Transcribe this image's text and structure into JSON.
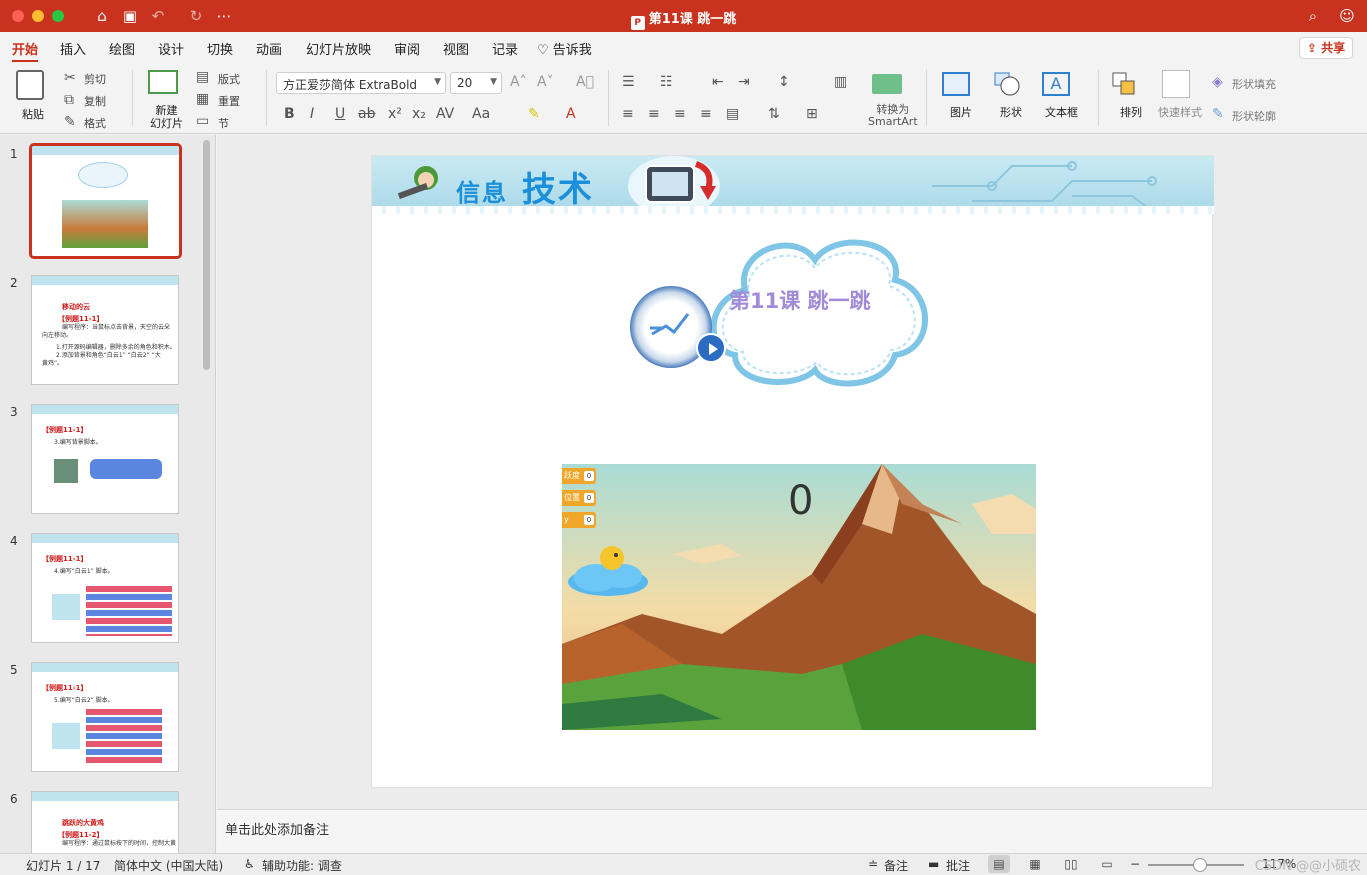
{
  "window": {
    "title": "第11课 跳一跳"
  },
  "ribbon_tabs": [
    "开始",
    "插入",
    "绘图",
    "设计",
    "切换",
    "动画",
    "幻灯片放映",
    "审阅",
    "视图",
    "记录"
  ],
  "tell_me": "告诉我",
  "share_label": "共享",
  "ribbon": {
    "paste": "粘贴",
    "cut": "剪切",
    "copy": "复制",
    "format": "格式",
    "new_slide": "新建\n幻灯片",
    "layout": "版式",
    "reset": "重置",
    "section": "节",
    "font_name": "方正爱莎简体 ExtraBold",
    "font_size": "20",
    "convert_smartart": "转换为\nSmartArt",
    "picture": "图片",
    "shape": "形状",
    "textbox": "文本框",
    "arrange": "排列",
    "quick_styles": "快速样式",
    "shape_fill": "形状填充",
    "shape_outline": "形状轮廓"
  },
  "thumbnails": [
    {
      "num": "1"
    },
    {
      "num": "2",
      "heading": "移动的云",
      "example": "【例题11-1】",
      "lines": [
        "编写程序：当鼠标点击背景，天空的云朵",
        "向左移动。",
        "1.打开源码编辑器，删除多余的角色和积木。",
        "2.添加背景和角色“白云1” “白云2” “大",
        "黄鸡”。"
      ]
    },
    {
      "num": "3",
      "example": "【例题11-1】",
      "lines": [
        "3.编写背景脚本。"
      ]
    },
    {
      "num": "4",
      "example": "【例题11-1】",
      "lines": [
        "4.编写“白云1” 脚本。"
      ]
    },
    {
      "num": "5",
      "example": "【例题11-1】",
      "lines": [
        "5.编写“白云2” 脚本。"
      ]
    },
    {
      "num": "6",
      "heading": "跳跃的大黄鸡",
      "example": "【例题11-2】",
      "lines": [
        "编写程序：通过鼠标按下的时间，控制大黄"
      ]
    }
  ],
  "slide": {
    "banner_title_small": "信息",
    "banner_title_big": "技术",
    "lesson_title": "第11课 跳一跳",
    "game": {
      "monitors": [
        {
          "label": "跃度",
          "value": "0"
        },
        {
          "label": "位置",
          "value": "0"
        },
        {
          "label": "y",
          "value": "0"
        }
      ],
      "score": "0"
    }
  },
  "notes_placeholder": "单击此处添加备注",
  "status": {
    "slide_counter": "幻灯片 1 / 17",
    "language": "简体中文 (中国大陆)",
    "accessibility": "辅助功能: 调查",
    "notes_btn": "备注",
    "comments_btn": "批注",
    "zoom": "117%",
    "watermark": "CSDN @@小硕农"
  },
  "colors": {
    "brand": "#c8321f",
    "lesson_title": "#a18ad8",
    "example_red": "#d01a1a"
  }
}
